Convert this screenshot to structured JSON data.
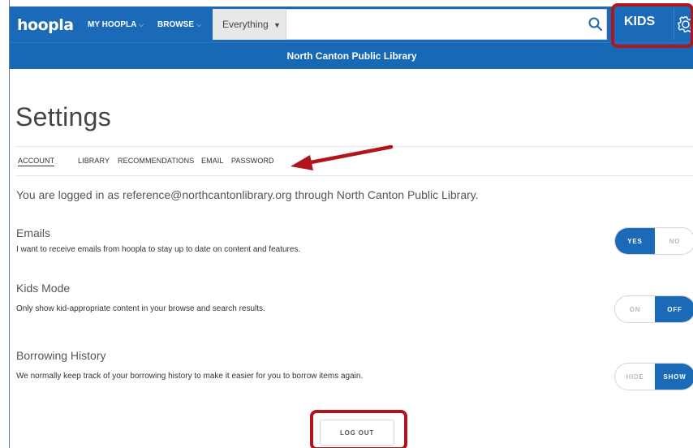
{
  "nav": {
    "logo": "hoopla",
    "my_hoopla": "MY HOOPLA",
    "browse": "BROWSE",
    "chevron": "⌵",
    "search_scope": "Everything",
    "kids_label": "KIDS"
  },
  "library_name": "North Canton Public Library",
  "page": {
    "title": "Settings",
    "tabs": [
      "ACCOUNT",
      "LIBRARY",
      "RECOMMENDATIONS",
      "EMAIL",
      "PASSWORD"
    ],
    "active_tab": "ACCOUNT",
    "logged_in_text": "You are logged in as reference@northcantonlibrary.org through North Canton Public Library."
  },
  "preferences": {
    "emails": {
      "title": "Emails",
      "description": "I want to receive emails from hoopla to stay up to date on content and features.",
      "options": [
        "YES",
        "NO"
      ],
      "selected": "YES"
    },
    "kids_mode": {
      "title": "Kids Mode",
      "description": "Only show kid-appropriate content in your browse and search results.",
      "options": [
        "ON",
        "OFF"
      ],
      "selected": "OFF"
    },
    "borrowing_history": {
      "title": "Borrowing History",
      "description": "We normally keep track of your borrowing history to make it easier for you to borrow items again.",
      "options": [
        "HIDE",
        "SHOW"
      ],
      "selected": "SHOW"
    }
  },
  "logout_label": "LOG OUT",
  "icons": {
    "search": "search-icon",
    "settings": "gear-icon",
    "dropdown": "caret-down-icon"
  },
  "colors": {
    "brand_blue": "#1a6ab7",
    "highlight_red": "#b0141c"
  }
}
